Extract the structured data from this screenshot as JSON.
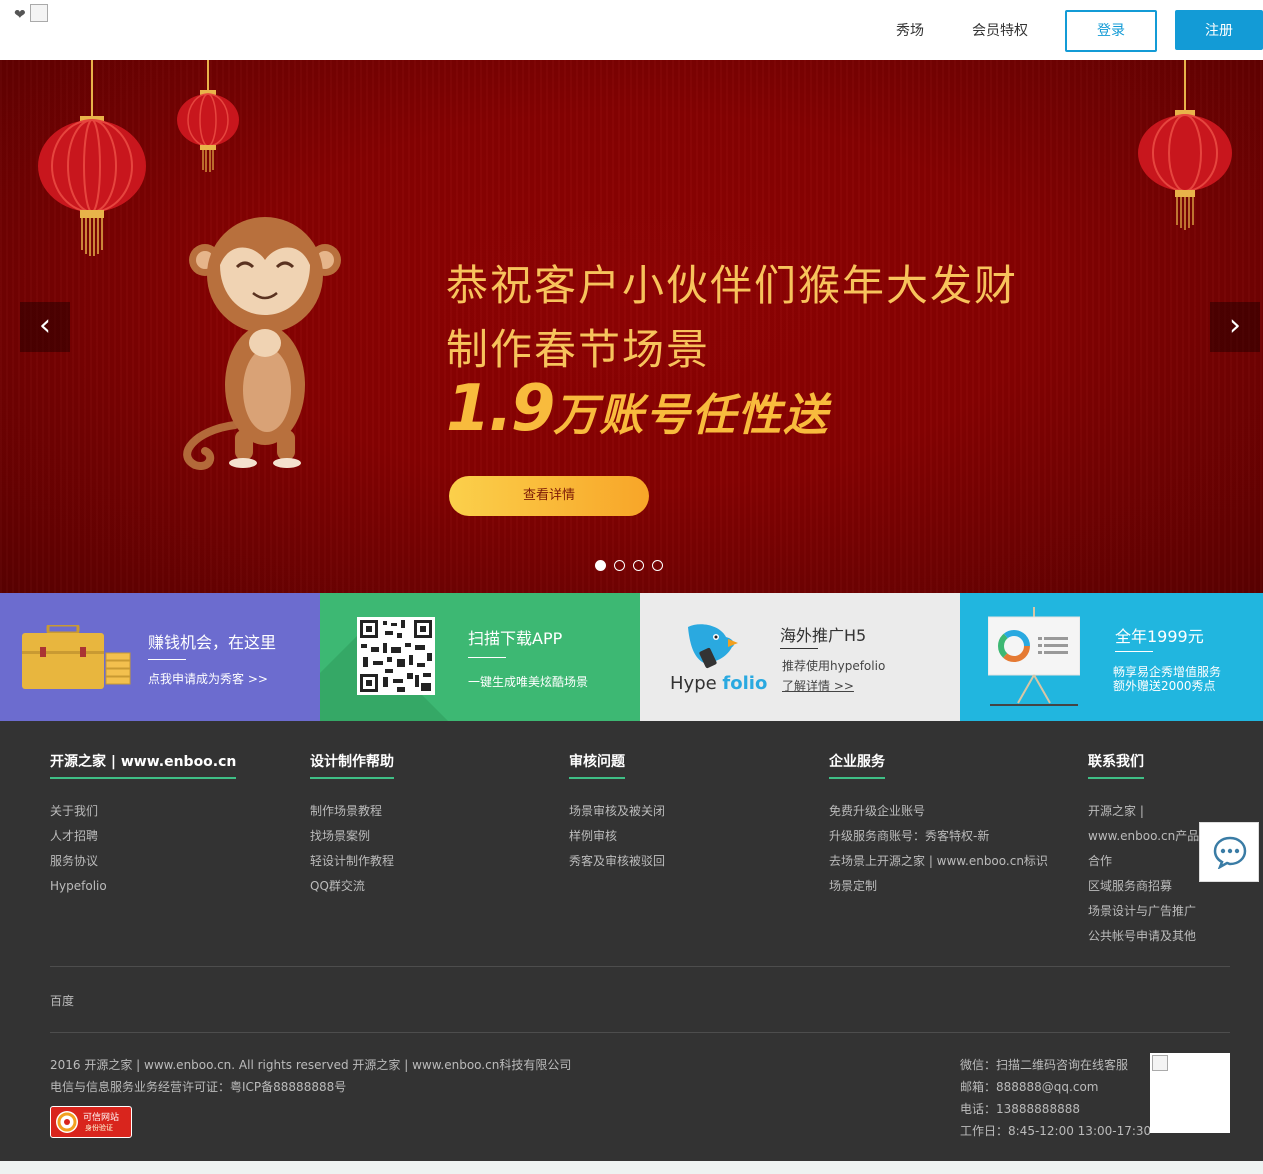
{
  "header": {
    "nav": [
      "秀场",
      "会员特权"
    ],
    "login": "登录",
    "register": "注册"
  },
  "banner": {
    "title": "恭祝客户小伙伴们猴年大发财",
    "subtitle": "制作春节场景",
    "big_number": "1.9",
    "big_rest": "万账号任性送",
    "button": "查看详情",
    "prev": "‹",
    "next": "›",
    "slides": 4,
    "active_slide": 1
  },
  "features": [
    {
      "title": "赚钱机会，在这里",
      "desc": "点我申请成为秀客 >>"
    },
    {
      "title": "扫描下载APP",
      "desc": "一键生成唯美炫酷场景"
    },
    {
      "title": "海外推广H5",
      "desc": "推荐使用hypefolio",
      "link": "了解详情 >>",
      "logo_a": "Hype",
      "logo_b": "folio"
    },
    {
      "title": "全年1999元",
      "desc1": "畅享易企秀增值服务",
      "desc2": "额外赠送2000秀点"
    }
  ],
  "footer": {
    "columns": [
      {
        "head": "开源之家 | www.enboo.cn",
        "items": [
          "关于我们",
          "人才招聘",
          "服务协议",
          "Hypefolio"
        ]
      },
      {
        "head": "设计制作帮助",
        "items": [
          "制作场景教程",
          "找场景案例",
          "轻设计制作教程",
          "QQ群交流"
        ]
      },
      {
        "head": "审核问题",
        "items": [
          "场景审核及被关闭",
          "样例审核",
          "秀客及审核被驳回"
        ]
      },
      {
        "head": "企业服务",
        "items": [
          "免费升级企业账号",
          "升级服务商账号：秀客特权-新",
          "去场景上开源之家 | www.enboo.cn标识",
          "场景定制"
        ]
      },
      {
        "head": "联系我们",
        "items": [
          "开源之家 |",
          "www.enboo.cn产品开",
          "合作",
          "区域服务商招募",
          "场景设计与广告推广",
          "公共帐号申请及其他"
        ]
      }
    ],
    "friend_link": "百度",
    "copyright": "2016 开源之家 | www.enboo.cn. All rights reserved 开源之家 | www.enboo.cn科技有限公司",
    "icp": "电信与信息服务业务经营许可证：粤ICP备88888888号",
    "contact": [
      "微信：扫描二维码咨询在线客服",
      "邮箱：888888@qq.com",
      "电话：13888888888",
      "工作日：8:45-12:00 13:00-17:30"
    ],
    "badge_text1": "可信网站",
    "badge_text2": "身份验证"
  },
  "colors": {
    "primary": "#139bd6",
    "banner": "#8f0303",
    "gold": "#f7c35c",
    "footer": "#333333"
  }
}
